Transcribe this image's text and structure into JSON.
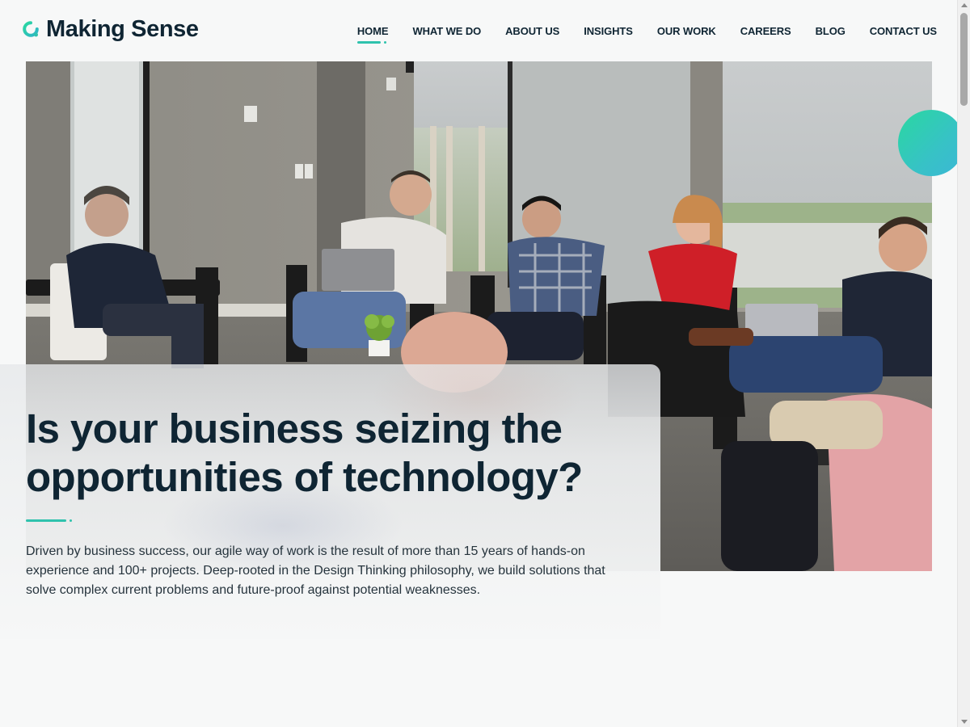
{
  "brand": {
    "name": "Making Sense",
    "logo_icon": "q-ring-logo-icon",
    "accent_color": "#2fc2ad",
    "text_color": "#0f2533"
  },
  "nav": {
    "items": [
      {
        "label": "HOME",
        "active": true
      },
      {
        "label": "WHAT WE DO",
        "active": false
      },
      {
        "label": "ABOUT US",
        "active": false
      },
      {
        "label": "INSIGHTS",
        "active": false
      },
      {
        "label": "OUR WORK",
        "active": false
      },
      {
        "label": "CAREERS",
        "active": false
      },
      {
        "label": "BLOG",
        "active": false
      },
      {
        "label": "CONTACT US",
        "active": false
      }
    ]
  },
  "hero": {
    "title_lines": [
      "Is your business seizing the",
      "opportunities of technology?"
    ],
    "description_lines": [
      "Driven by business success, our agile way of work is the result of more than 15 years of hands-on",
      "experience and 100+ projects. Deep-rooted in the Design Thinking philosophy, we build solutions that",
      "solve complex current problems and future-proof against potential weaknesses."
    ],
    "photo_icon": "team-meeting-photo",
    "decor_icon": "gradient-circle-icon"
  }
}
